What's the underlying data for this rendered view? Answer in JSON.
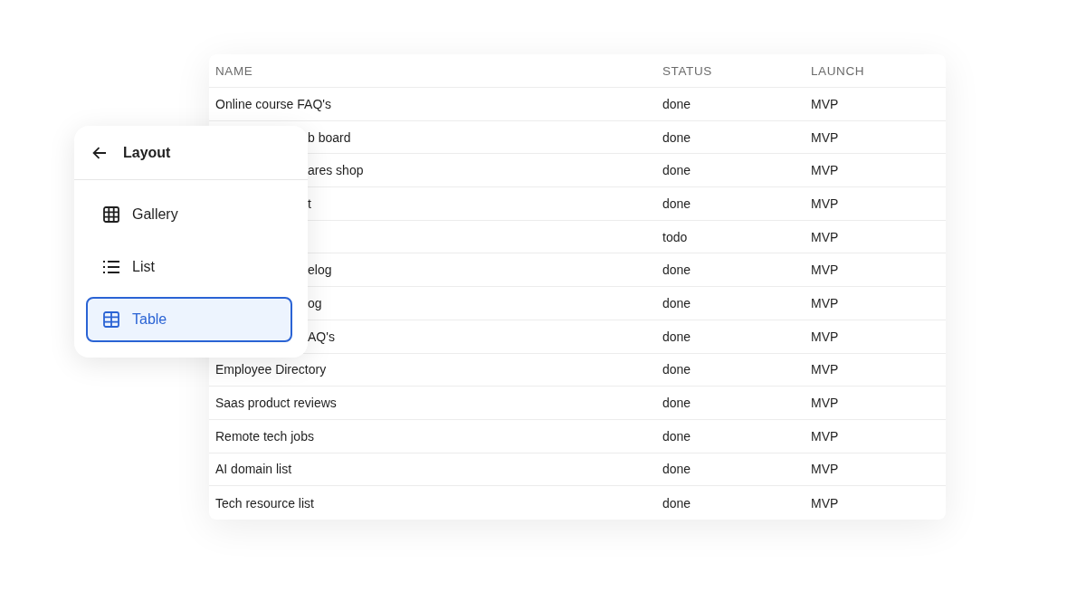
{
  "table": {
    "columns": [
      "NAME",
      "STATUS",
      "LAUNCH"
    ],
    "rows": [
      {
        "name": "Online course FAQ's",
        "kind": "full",
        "status": "done",
        "launch": "MVP"
      },
      {
        "name": "b board",
        "kind": "clipped",
        "status": "done",
        "launch": "MVP"
      },
      {
        "name": "ares shop",
        "kind": "clipped",
        "status": "done",
        "launch": "MVP"
      },
      {
        "name": "t",
        "kind": "clipped",
        "status": "done",
        "launch": "MVP"
      },
      {
        "status": "todo",
        "launch": "MVP"
      },
      {
        "name": "elog",
        "kind": "clipped",
        "status": "done",
        "launch": "MVP"
      },
      {
        "name": "og",
        "kind": "clipped",
        "status": "done",
        "launch": "MVP"
      },
      {
        "name": "AQ's",
        "kind": "clipped",
        "status": "done",
        "launch": "MVP"
      },
      {
        "name": "Employee Directory",
        "kind": "full",
        "status": "done",
        "launch": "MVP"
      },
      {
        "name": "Saas product reviews",
        "kind": "full",
        "status": "done",
        "launch": "MVP"
      },
      {
        "name": "Remote tech jobs",
        "kind": "full",
        "status": "done",
        "launch": "MVP"
      },
      {
        "name": "AI domain list",
        "kind": "full",
        "status": "done",
        "launch": "MVP"
      },
      {
        "name": "Tech resource list",
        "kind": "full",
        "status": "done",
        "launch": "MVP"
      }
    ]
  },
  "layout_menu": {
    "title": "Layout",
    "items": [
      {
        "label": "Gallery",
        "kind": "grid",
        "selected": false
      },
      {
        "label": "List",
        "kind": "list",
        "selected": false
      },
      {
        "label": "Table",
        "kind": "table",
        "selected": true
      }
    ]
  }
}
